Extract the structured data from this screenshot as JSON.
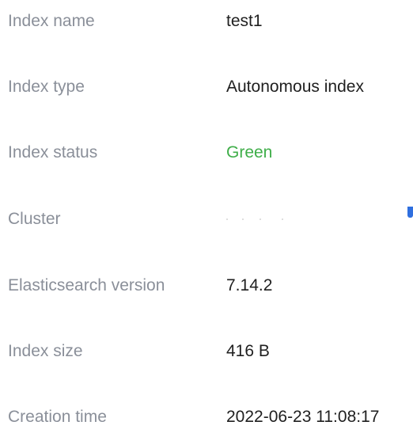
{
  "details": {
    "rows": [
      {
        "label": "Index name",
        "value": "test1"
      },
      {
        "label": "Index type",
        "value": "Autonomous index"
      },
      {
        "label": "Index status",
        "value": "Green"
      },
      {
        "label": "Cluster",
        "value": ""
      },
      {
        "label": "Elasticsearch version",
        "value": "7.14.2"
      },
      {
        "label": "Index size",
        "value": "416 B"
      },
      {
        "label": "Creation time",
        "value": "2022-06-23 11:08:17"
      }
    ]
  },
  "colors": {
    "label": "#8a8f99",
    "value": "#1f1f1f",
    "status_green": "#3fae49",
    "cluster_icon": "#2f6fdf"
  },
  "icons": {
    "cluster_edge_icon": "cluster-link-icon"
  }
}
